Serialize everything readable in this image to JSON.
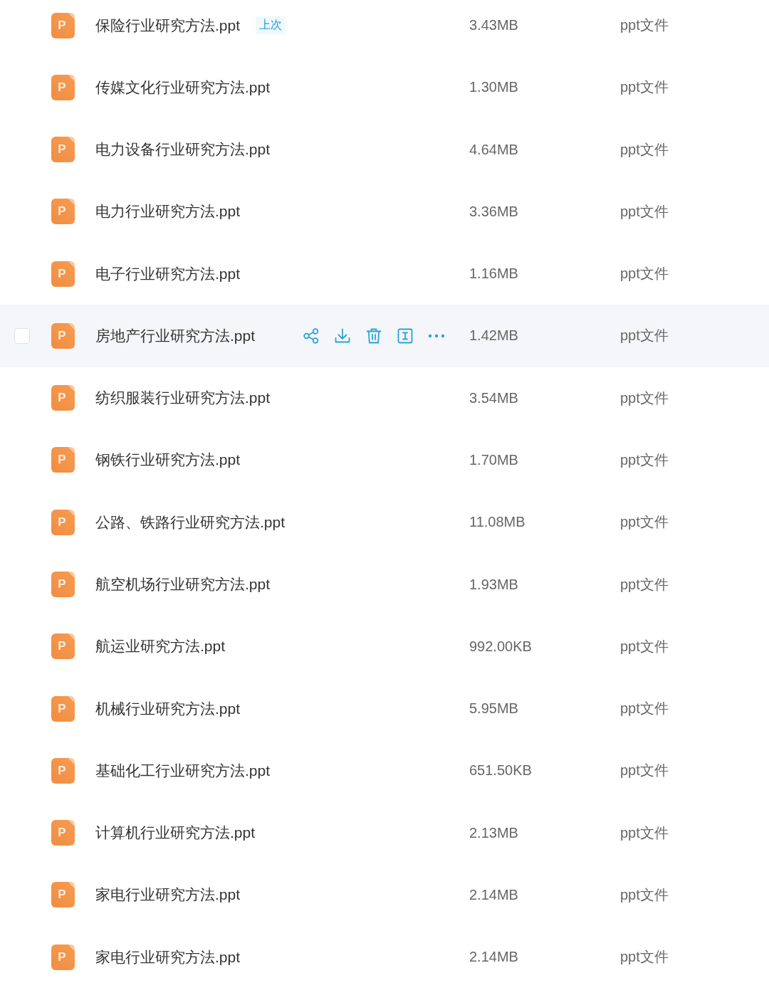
{
  "file_list": {
    "rows": [
      {
        "icon_letter": "P",
        "name": "保险行业研究方法.ppt",
        "badge": "上次",
        "size": "3.43MB",
        "type": "ppt文件",
        "highlighted": false
      },
      {
        "icon_letter": "P",
        "name": "传媒文化行业研究方法.ppt",
        "size": "1.30MB",
        "type": "ppt文件",
        "highlighted": false
      },
      {
        "icon_letter": "P",
        "name": "电力设备行业研究方法.ppt",
        "size": "4.64MB",
        "type": "ppt文件",
        "highlighted": false
      },
      {
        "icon_letter": "P",
        "name": "电力行业研究方法.ppt",
        "size": "3.36MB",
        "type": "ppt文件",
        "highlighted": false
      },
      {
        "icon_letter": "P",
        "name": "电子行业研究方法.ppt",
        "size": "1.16MB",
        "type": "ppt文件",
        "highlighted": false
      },
      {
        "icon_letter": "P",
        "name": "房地产行业研究方法.ppt",
        "size": "1.42MB",
        "type": "ppt文件",
        "highlighted": true,
        "checked": false
      },
      {
        "icon_letter": "P",
        "name": "纺织服装行业研究方法.ppt",
        "size": "3.54MB",
        "type": "ppt文件",
        "highlighted": false
      },
      {
        "icon_letter": "P",
        "name": "钢铁行业研究方法.ppt",
        "size": "1.70MB",
        "type": "ppt文件",
        "highlighted": false
      },
      {
        "icon_letter": "P",
        "name": "公路、铁路行业研究方法.ppt",
        "size": "11.08MB",
        "type": "ppt文件",
        "highlighted": false
      },
      {
        "icon_letter": "P",
        "name": "航空机场行业研究方法.ppt",
        "size": "1.93MB",
        "type": "ppt文件",
        "highlighted": false
      },
      {
        "icon_letter": "P",
        "name": "航运业研究方法.ppt",
        "size": "992.00KB",
        "type": "ppt文件",
        "highlighted": false
      },
      {
        "icon_letter": "P",
        "name": "机械行业研究方法.ppt",
        "size": "5.95MB",
        "type": "ppt文件",
        "highlighted": false
      },
      {
        "icon_letter": "P",
        "name": "基础化工行业研究方法.ppt",
        "size": "651.50KB",
        "type": "ppt文件",
        "highlighted": false
      },
      {
        "icon_letter": "P",
        "name": "计算机行业研究方法.ppt",
        "size": "2.13MB",
        "type": "ppt文件",
        "highlighted": false
      },
      {
        "icon_letter": "P",
        "name": "家电行业研究方法.ppt",
        "size": "2.14MB",
        "type": "ppt文件",
        "highlighted": false
      },
      {
        "icon_letter": "P",
        "name": "家电行业研究方法.ppt",
        "size": "2.14MB",
        "type": "ppt文件",
        "highlighted": false
      }
    ]
  }
}
